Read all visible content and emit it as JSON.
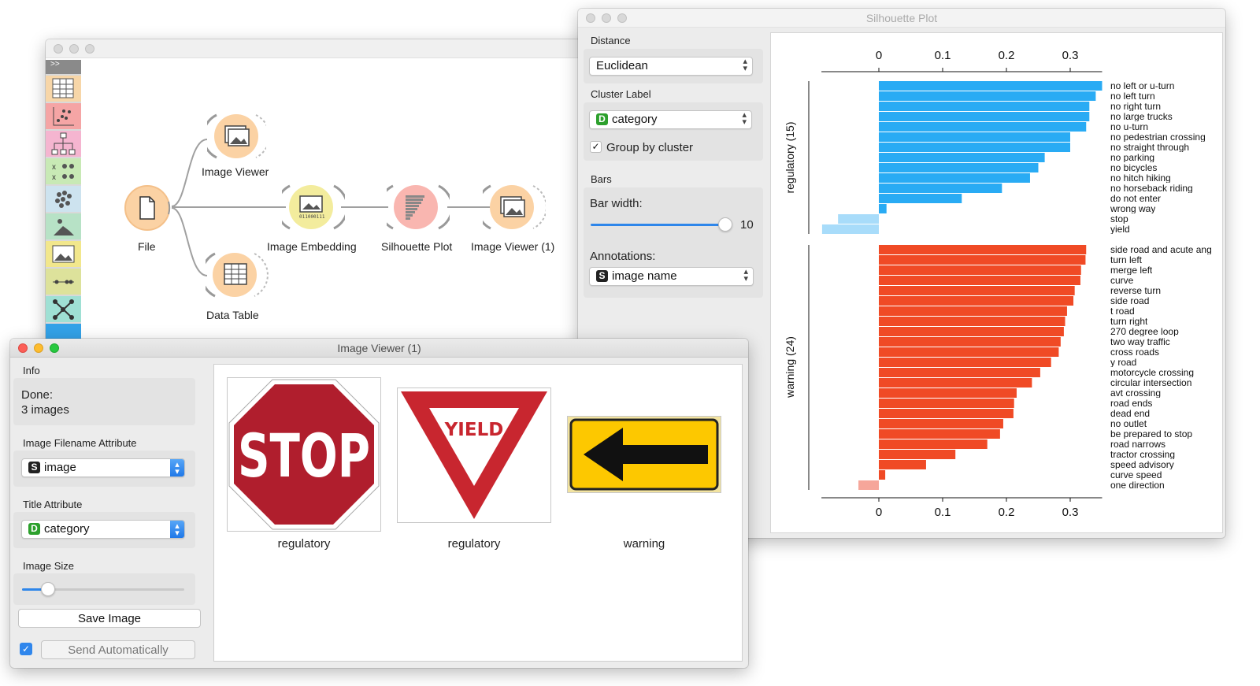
{
  "canvas": {
    "nodes": {
      "file": "File",
      "image_viewer": "Image Viewer",
      "image_embedding": "Image Embedding",
      "silhouette_plot": "Silhouette Plot",
      "image_viewer_1": "Image Viewer (1)",
      "data_table": "Data Table"
    }
  },
  "silhouette": {
    "title": "Silhouette Plot",
    "distance_label": "Distance",
    "distance_value": "Euclidean",
    "cluster_label_label": "Cluster Label",
    "cluster_label_value": "category",
    "group_by_cluster": "Group by cluster",
    "bars_label": "Bars",
    "bar_width_label": "Bar width:",
    "bar_width_value": "10",
    "annotations_label": "Annotations:",
    "annotations_value": "image name"
  },
  "chart_data": {
    "type": "bar",
    "orientation": "horizontal",
    "xlim": [
      -0.09,
      0.35
    ],
    "xticks": [
      "0",
      "0.1",
      "0.2",
      "0.3"
    ],
    "grid": false,
    "groups": [
      {
        "name": "regulatory (15)",
        "color": "#29abf4",
        "neg_color": "#a8dcfa",
        "labels": [
          "no left or u-turn",
          "no left turn",
          "no right turn",
          "no large trucks",
          "no u-turn",
          "no pedestrian crossing",
          "no straight through",
          "no parking",
          "no bicycles",
          "no hitch hiking",
          "no horseback riding",
          "do not enter",
          "wrong way",
          "stop",
          "yield"
        ],
        "values": [
          0.35,
          0.34,
          0.33,
          0.33,
          0.325,
          0.3,
          0.3,
          0.26,
          0.25,
          0.237,
          0.193,
          0.13,
          0.012,
          -0.064,
          -0.089
        ]
      },
      {
        "name": "warning (24)",
        "color": "#f04a25",
        "neg_color": "#f6a69a",
        "labels": [
          "side road and acute ang",
          "turn left",
          "merge left",
          "curve",
          "reverse turn",
          "side road",
          "t road",
          "turn right",
          "270 degree loop",
          "two way traffic",
          "cross roads",
          "y road",
          "motorcycle crossing",
          "circular intersection",
          "avt crossing",
          "road ends",
          "dead end",
          "no outlet",
          "be prepared to stop",
          "road narrows",
          "tractor crossing",
          "speed advisory",
          "curve speed",
          "one direction"
        ],
        "values": [
          0.325,
          0.324,
          0.317,
          0.316,
          0.307,
          0.305,
          0.295,
          0.292,
          0.29,
          0.285,
          0.282,
          0.27,
          0.253,
          0.24,
          0.216,
          0.212,
          0.211,
          0.195,
          0.19,
          0.17,
          0.12,
          0.074,
          0.01,
          -0.032
        ]
      }
    ]
  },
  "viewer": {
    "title": "Image Viewer (1)",
    "info_label": "Info",
    "info_line1": "Done:",
    "info_line2": "3 images",
    "filename_attr_label": "Image Filename Attribute",
    "filename_attr_value": "image",
    "title_attr_label": "Title Attribute",
    "title_attr_value": "category",
    "image_size_label": "Image Size",
    "image_size_fraction": 0.16,
    "save_image": "Save Image",
    "send_automatically": "Send Automatically",
    "images": [
      {
        "sign_text": "STOP",
        "caption": "regulatory"
      },
      {
        "sign_text": "YIELD",
        "caption": "regulatory"
      },
      {
        "sign_text": "",
        "caption": "warning"
      }
    ]
  }
}
